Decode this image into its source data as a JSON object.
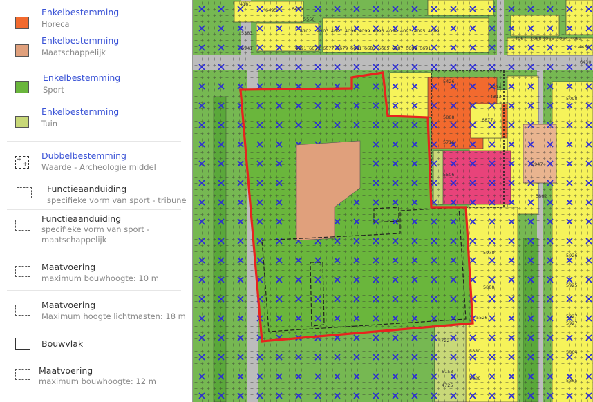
{
  "legend": {
    "items": [
      {
        "title": "Enkelbestemming",
        "subtitle": "Horeca",
        "swatch": "solid",
        "color": "#f26a2e",
        "title_color": "#3a53d6"
      },
      {
        "title": "Enkelbestemming",
        "subtitle": "Maatschappelijk",
        "swatch": "solid",
        "color": "#e0a07c",
        "title_color": "#3a53d6"
      },
      {
        "title": "Enkelbestemming",
        "subtitle": "Sport",
        "swatch": "solid",
        "color": "#6ab63c",
        "title_color": "#3a53d6"
      },
      {
        "title": "Enkelbestemming",
        "subtitle": "Tuin",
        "swatch": "solid",
        "color": "#c8d878",
        "title_color": "#3a53d6"
      },
      {
        "title": "Dubbelbestemming",
        "subtitle": "Waarde - Archeologie middel",
        "swatch": "cross-dashed",
        "title_color": "#3a53d6"
      },
      {
        "title": "Functieaanduiding",
        "subtitle": "specifieke vorm van sport - tribune",
        "swatch": "dashed",
        "title_color": "#333333"
      },
      {
        "title": "Functieaanduiding",
        "subtitle": "specifieke vorm van sport -",
        "subtitle2": "maatschappelijk",
        "swatch": "dashed",
        "title_color": "#333333"
      },
      {
        "title": "Maatvoering",
        "subtitle": "maximum bouwhoogte: 10 m",
        "swatch": "dashed",
        "title_color": "#333333"
      },
      {
        "title": "Maatvoering",
        "subtitle": "Maximum hoogte lichtmasten: 18 m",
        "swatch": "dashed",
        "title_color": "#333333"
      },
      {
        "title": "Bouwvlak",
        "subtitle": "",
        "swatch": "solid-outline",
        "title_color": "#333333"
      },
      {
        "title": "Maatvoering",
        "subtitle": "maximum bouwhoogte: 12 m",
        "swatch": "dashed",
        "title_color": "#333333"
      }
    ]
  },
  "map": {
    "plot_numbers": [
      "6495",
      "6459",
      "5550",
      "4181",
      "5383",
      "6941",
      "4102",
      "4103",
      "4097",
      "4098",
      "4099",
      "4096",
      "4094",
      "4093",
      "4095",
      "4089",
      "4091",
      "6673",
      "6677",
      "6679",
      "6681",
      "6683",
      "6685",
      "6687",
      "6689",
      "6691",
      "4067",
      "4068",
      "4065",
      "4064",
      "4063",
      "4430",
      "4214",
      "4313",
      "5426",
      "5888",
      "5716",
      "6877",
      "5506",
      "5947",
      "5862",
      "5098",
      "5926",
      "5927",
      "5978",
      "5888",
      "5526",
      "5925",
      "5927",
      "5864",
      "5865",
      "5830",
      "5629",
      "6153",
      "4722",
      "4725",
      "6430"
    ],
    "colors": {
      "sport": "#6ab63c",
      "plan_boundary": "#e8231e",
      "horeca": "#f26a2e",
      "maatschappelijk": "#e0a07c",
      "wonen": "#f6f35a",
      "road": "#bcbcbc",
      "tuin": "#c8d878",
      "pink": "#e8437a",
      "cross_marker": "#2a2ad8"
    }
  }
}
